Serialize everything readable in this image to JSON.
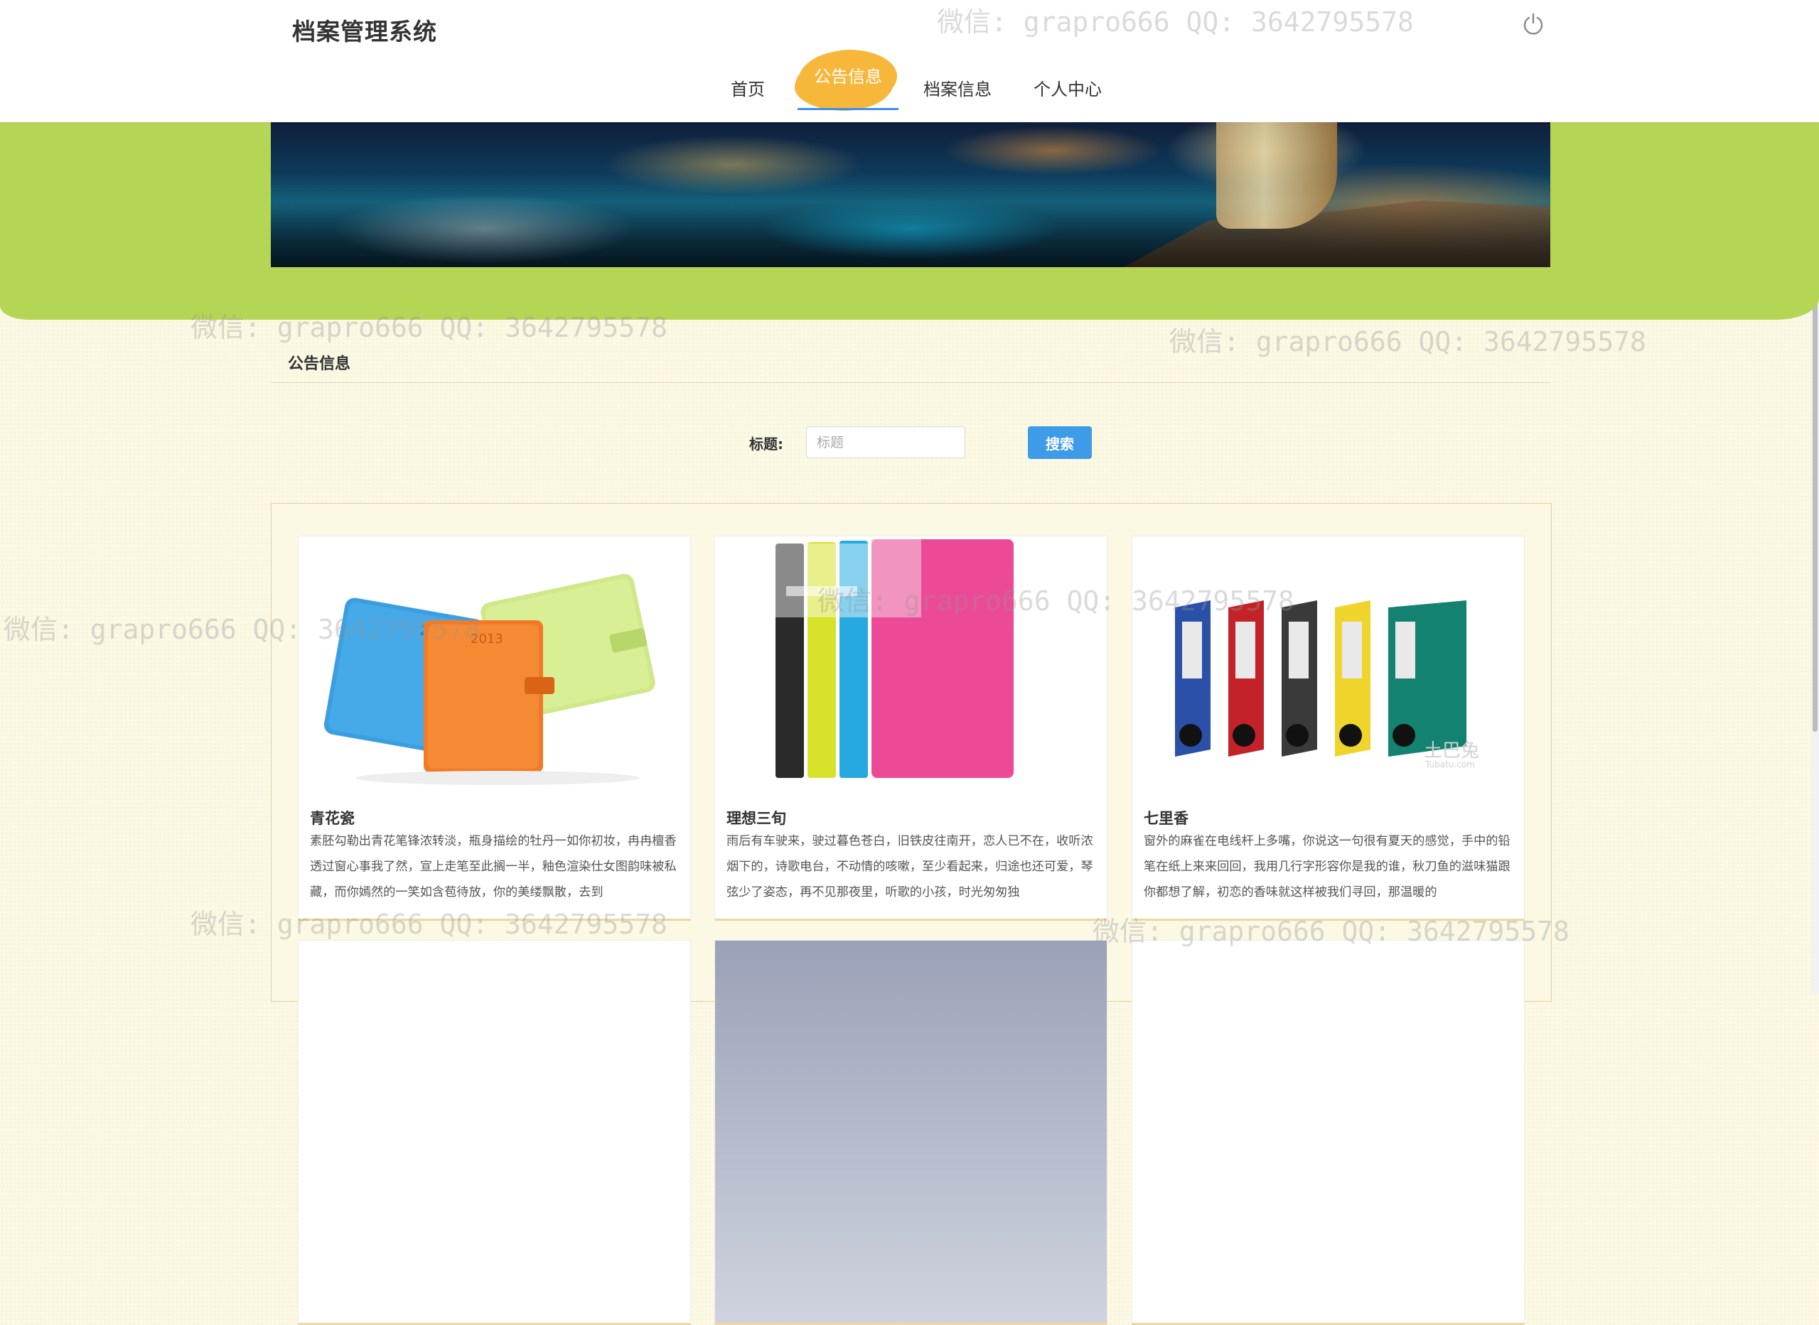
{
  "header": {
    "site_title": "档案管理系统",
    "nav": [
      {
        "label": "首页",
        "active": false
      },
      {
        "label": "公告信息",
        "active": true
      },
      {
        "label": "档案信息",
        "active": false
      },
      {
        "label": "个人中心",
        "active": false
      }
    ],
    "power_icon": "power-icon"
  },
  "section": {
    "title": "公告信息"
  },
  "search": {
    "label": "标题:",
    "placeholder": "标题",
    "value": "",
    "button_label": "搜索"
  },
  "cards": [
    {
      "title": "青花瓷",
      "description": "素胚勾勒出青花笔锋浓转淡，瓶身描绘的牡丹一如你初妆，冉冉檀香透过窗心事我了然，宣上走笔至此搁一半，釉色渲染仕女图韵味被私藏，而你嫣然的一笑如含苞待放，你的美缕飘散，去到",
      "image": "notebooks-image",
      "image_text": [
        "2013",
        "2013"
      ]
    },
    {
      "title": "理想三旬",
      "description": "雨后有车驶来，驶过暮色苍白，旧铁皮往南开，恋人已不在，收听浓烟下的，诗歌电台，不动情的咳嗽，至少看起来，归途也还可爱，琴弦少了姿态，再不见那夜里，听歌的小孩，时光匆匆独",
      "image": "folders-image"
    },
    {
      "title": "七里香",
      "description": "窗外的麻雀在电线杆上多嘴，你说这一句很有夏天的感觉，手中的铅笔在纸上来来回回，我用几行字形容你是我的谁，秋刀鱼的滋味猫跟你都想了解，初恋的香味就这样被我们寻回，那温暖的",
      "image": "binders-image",
      "image_text": [
        "土巴兔",
        "Tubatu.com"
      ]
    }
  ],
  "watermark": "微信: grapro666 QQ: 3642795578",
  "colors": {
    "accent_orange": "#f7b73a",
    "green_band": "#b5d554",
    "button_blue": "#3e9be8",
    "background": "#fbf8e4"
  }
}
